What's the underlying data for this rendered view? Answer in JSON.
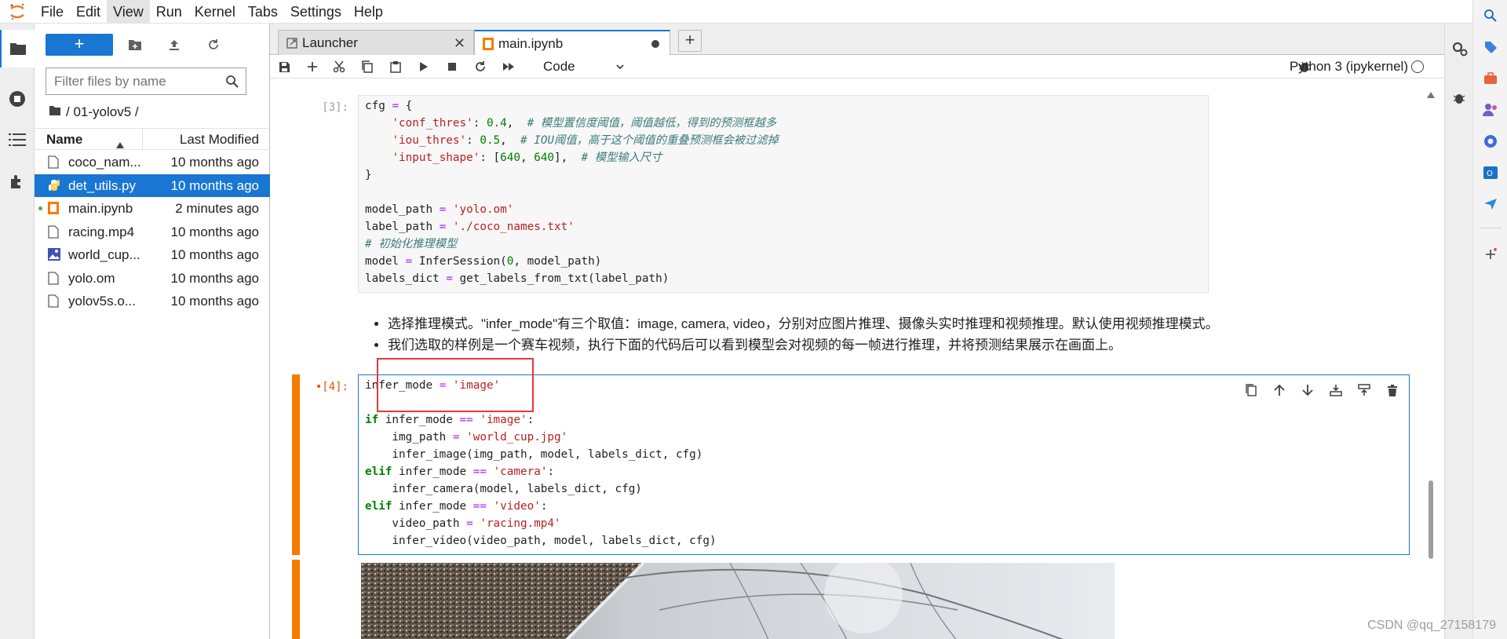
{
  "menubar": {
    "items": [
      "File",
      "Edit",
      "View",
      "Run",
      "Kernel",
      "Tabs",
      "Settings",
      "Help"
    ],
    "active": "View"
  },
  "filebrowser": {
    "new_label": "+",
    "filter_placeholder": "Filter files by name",
    "breadcrumb": "/ 01-yolov5 /",
    "col_name": "Name",
    "col_modified": "Last Modified",
    "files": [
      {
        "name": "coco_nam...",
        "modified": "10 months ago",
        "icon": "file-icon"
      },
      {
        "name": "det_utils.py",
        "modified": "10 months ago",
        "icon": "python-icon",
        "selected": true
      },
      {
        "name": "main.ipynb",
        "modified": "2 minutes ago",
        "icon": "notebook-icon",
        "running": true
      },
      {
        "name": "racing.mp4",
        "modified": "10 months ago",
        "icon": "file-icon"
      },
      {
        "name": "world_cup...",
        "modified": "10 months ago",
        "icon": "image-icon"
      },
      {
        "name": "yolo.om",
        "modified": "10 months ago",
        "icon": "file-icon"
      },
      {
        "name": "yolov5s.o...",
        "modified": "10 months ago",
        "icon": "file-icon"
      }
    ]
  },
  "tabs": [
    {
      "label": "Launcher"
    },
    {
      "label": "main.ipynb",
      "current": true,
      "unsaved": true
    }
  ],
  "toolbar": {
    "cell_type": "Code",
    "kernel": "Python 3 (ipykernel)"
  },
  "cells": {
    "cell3": {
      "prompt": "[3]:"
    },
    "cell4": {
      "prompt": "•[4]:"
    }
  },
  "markdown": {
    "bullets": [
      "选择推理模式。\"infer_mode\"有三个取值：image, camera, video，分别对应图片推理、摄像头实时推理和视频推理。默认使用视频推理模式。",
      "我们选取的样例是一个赛车视频，执行下面的代码后可以看到模型会对视频的每一帧进行推理，并将预测结果展示在画面上。"
    ]
  },
  "colors": {
    "accent": "#1976d2",
    "active_cell": "#f57c00",
    "highlight": "#e53935"
  },
  "watermark": "CSDN @qq_27158179"
}
